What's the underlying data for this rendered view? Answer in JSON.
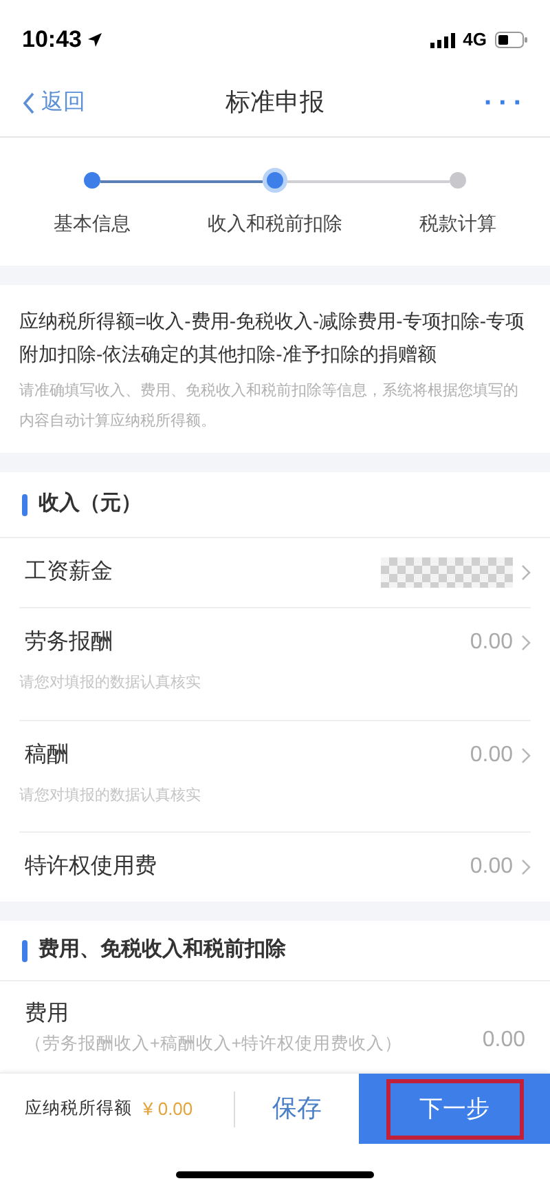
{
  "status_bar": {
    "time": "10:43",
    "network": "4G"
  },
  "nav": {
    "back": "返回",
    "title": "标准申报",
    "more": "···"
  },
  "steps": [
    {
      "label": "基本信息",
      "completed": true,
      "selected": false
    },
    {
      "label": "收入和税前扣除",
      "completed": true,
      "selected": true
    },
    {
      "label": "税款计算",
      "completed": false,
      "selected": false
    }
  ],
  "formula": {
    "text": "应纳税所得额=收入-费用-免税收入-减除费用-专项扣除-专项附加扣除-依法确定的其他扣除-准予扣除的捐赠额",
    "hint": "请准确填写收入、费用、免税收入和税前扣除等信息，系统将根据您填写的内容自动计算应纳税所得额。"
  },
  "income": {
    "title": "收入（元）",
    "rows": [
      {
        "label": "工资薪金",
        "masked": true
      },
      {
        "label": "劳务报酬",
        "value": "0.00",
        "masked": false,
        "note": "请您对填报的数据认真核实"
      },
      {
        "label": "稿酬",
        "value": "0.00",
        "masked": false,
        "note": "请您对填报的数据认真核实"
      },
      {
        "label": "特许权使用费",
        "value": "0.00",
        "masked": false
      }
    ]
  },
  "expenses": {
    "title": "费用、免税收入和税前扣除",
    "rows": [
      {
        "label": "费用",
        "formula": "（劳务报酬收入+稿酬收入+特许权使用费收入）",
        "value": "0.00"
      }
    ]
  },
  "footer": {
    "label": "应纳税所得额",
    "amount": "¥ 0.00",
    "save": "保存",
    "next": "下一步",
    "next_highlighted": true
  }
}
